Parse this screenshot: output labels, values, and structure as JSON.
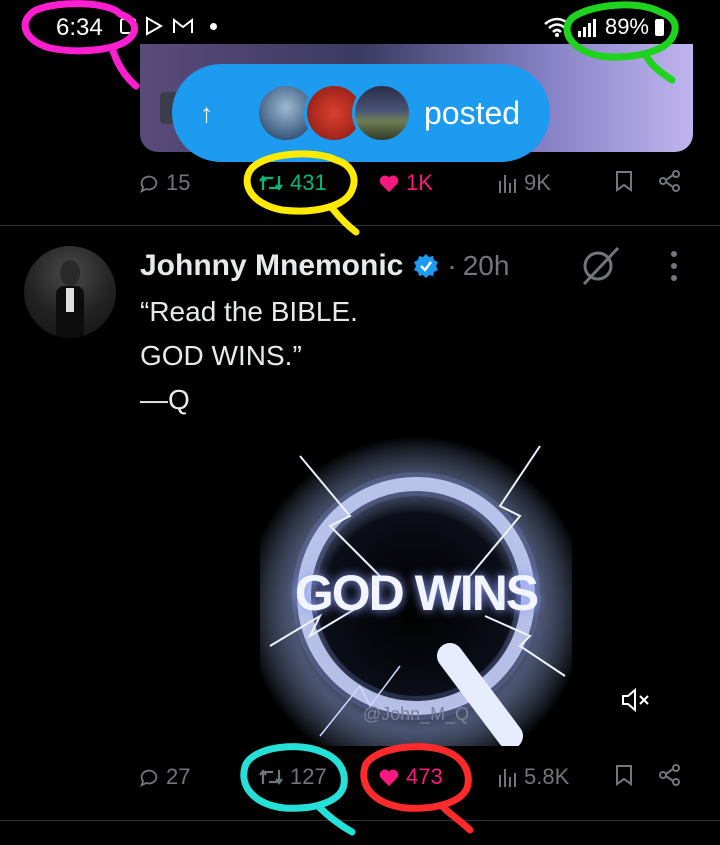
{
  "status_bar": {
    "time": "6:34",
    "battery": "89%"
  },
  "prev_post": {
    "toast_label": "posted",
    "actions": {
      "replies": "15",
      "reposts": "431",
      "likes": "1K",
      "views": "9K"
    }
  },
  "tweet": {
    "author": "Johnny Mnemonic",
    "separator": "·",
    "age": "20h",
    "text": "“Read the BIBLE.\nGOD WINS.”\n—Q",
    "media": {
      "overlay_text": "GOD WINS",
      "watermark": "@John_M_Q"
    },
    "actions": {
      "replies": "27",
      "reposts": "127",
      "likes": "473",
      "views": "5.8K"
    }
  },
  "colors": {
    "accent": "#1d9bf0",
    "repost_active": "#00ba7c",
    "like_active": "#f91880",
    "muted": "#71767b",
    "annotation_magenta": "#ff1fd1",
    "annotation_green": "#1ed31e",
    "annotation_yellow": "#ffea00",
    "annotation_cyan": "#25e0d6",
    "annotation_red": "#ff2a2a"
  },
  "icons": [
    "reply-icon",
    "repost-icon",
    "like-icon",
    "views-icon",
    "bookmark-icon",
    "share-icon",
    "verified-icon",
    "grok-icon",
    "more-icon",
    "mute-icon",
    "wifi-icon",
    "signal-icon"
  ]
}
